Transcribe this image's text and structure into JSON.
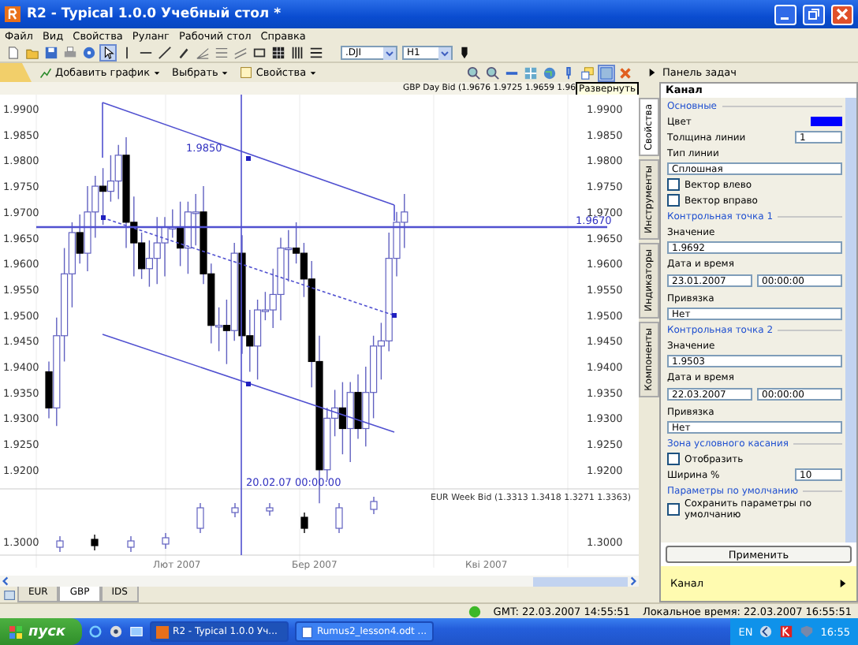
{
  "window": {
    "title": "R2 - Typical 1.0.0 Учебный стол *"
  },
  "menu": [
    "Файл",
    "Вид",
    "Свойства",
    "Руланг",
    "Рабочий стол",
    "Справка"
  ],
  "toolbar": {
    "symbol": ".DJI",
    "period": "H1"
  },
  "chart_toolbar": [
    "Добавить график",
    "Выбрать",
    "Свойства"
  ],
  "task_panel_label": "Панель задач",
  "tooltip": "Развернуть",
  "chart": {
    "header": "GBP Day Bid (1.9676 1.9725 1.9659 1.96",
    "left_ticks": [
      "1.9900",
      "1.9850",
      "1.9800",
      "1.9750",
      "1.9700",
      "1.9650",
      "1.9600",
      "1.9550",
      "1.9500",
      "1.9450",
      "1.9400",
      "1.9350",
      "1.9300",
      "1.9250",
      "1.9200"
    ],
    "right_ticks": [
      "1.9900",
      "1.9850",
      "1.9800",
      "1.9750",
      "1.9700",
      "1.9650",
      "1.9600",
      "1.9550",
      "1.9500",
      "1.9450",
      "1.9400",
      "1.9350",
      "1.9300",
      "1.9250",
      "1.9200"
    ],
    "level_label": "1.9670",
    "channel_label": "1.9850",
    "date_label": "20.02.07 00:00:00",
    "lower_header": "EUR Week Bid (1.3313 1.3418 1.3271 1.3363)",
    "lower_left_tick": "1.3000",
    "lower_right_tick": "1.3000",
    "months": [
      "Лют 2007",
      "Бер 2007",
      "Кві 2007"
    ]
  },
  "sheet_tabs": [
    {
      "label": "EUR",
      "selected": false
    },
    {
      "label": "GBP",
      "selected": true
    },
    {
      "label": "IDS",
      "selected": false
    }
  ],
  "side_tabs": [
    {
      "label": "Свойства",
      "selected": true
    },
    {
      "label": "Инструменты",
      "selected": false
    },
    {
      "label": "Индикаторы",
      "selected": false
    },
    {
      "label": "Компоненты",
      "selected": false
    }
  ],
  "properties": {
    "title": "Канал",
    "rows": [
      {
        "kind": "group",
        "label": "Основные"
      },
      {
        "kind": "color",
        "label": "Цвет",
        "color": "#0000ff"
      },
      {
        "kind": "spin",
        "label": "Толщина линии",
        "value": "1"
      },
      {
        "kind": "label",
        "label": "Тип линии"
      },
      {
        "kind": "select",
        "value": "Сплошная"
      },
      {
        "kind": "checkbox",
        "label": "Вектор влево",
        "checked": false
      },
      {
        "kind": "checkbox",
        "label": "Вектор вправо",
        "checked": false
      },
      {
        "kind": "group",
        "label": "Контрольная точка 1"
      },
      {
        "kind": "label",
        "label": "Значение"
      },
      {
        "kind": "text",
        "value": "1.9692"
      },
      {
        "kind": "label",
        "label": "Дата и время"
      },
      {
        "kind": "datetime",
        "date": "23.01.2007",
        "time": "00:00:00"
      },
      {
        "kind": "label",
        "label": "Привязка"
      },
      {
        "kind": "select",
        "value": "Нет"
      },
      {
        "kind": "group",
        "label": "Контрольная точка 2"
      },
      {
        "kind": "label",
        "label": "Значение"
      },
      {
        "kind": "text",
        "value": "1.9503"
      },
      {
        "kind": "label",
        "label": "Дата и время"
      },
      {
        "kind": "datetime",
        "date": "22.03.2007",
        "time": "00:00:00"
      },
      {
        "kind": "label",
        "label": "Привязка"
      },
      {
        "kind": "select",
        "value": "Нет"
      },
      {
        "kind": "group",
        "label": "Зона условного касания"
      },
      {
        "kind": "checkbox",
        "label": "Отобразить",
        "checked": false
      },
      {
        "kind": "spin",
        "label": "Ширина %",
        "value": "10"
      },
      {
        "kind": "group",
        "label": "Параметры по умолчанию"
      },
      {
        "kind": "checkbox",
        "label": "Сохранить параметры по умолчанию",
        "checked": false
      }
    ],
    "apply": "Применить",
    "footer": "Канал"
  },
  "status": {
    "gmt": "GMT: 22.03.2007 14:55:51",
    "local": "Локальное время: 22.03.2007 16:55:51"
  },
  "taskbar": {
    "start": "пуск",
    "tasks": [
      {
        "label": "R2 - Typical 1.0.0 Уч...",
        "selected": true
      },
      {
        "label": "Rumus2_lesson4.odt ...",
        "selected": false
      }
    ],
    "lang": "EN",
    "clock": "16:55"
  }
}
